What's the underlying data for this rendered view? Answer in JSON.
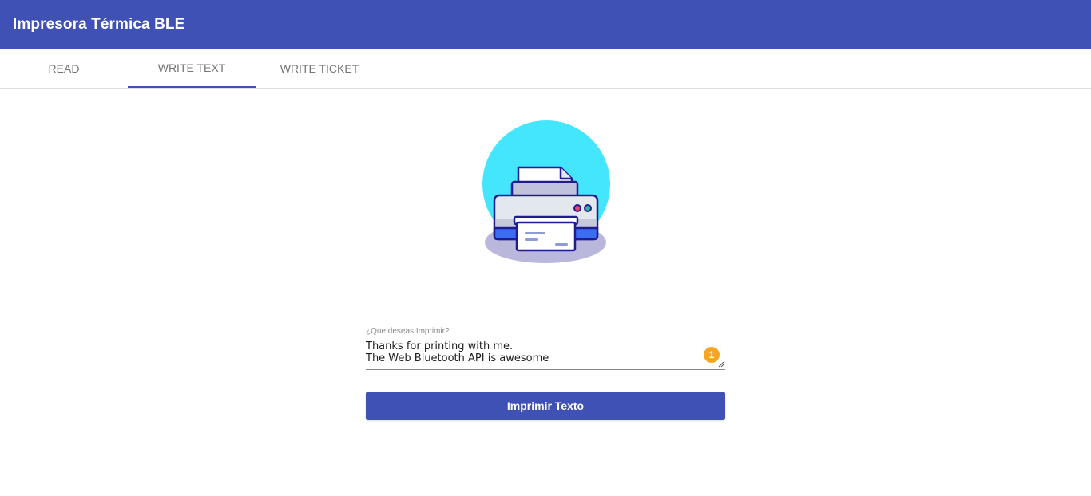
{
  "app": {
    "title": "Impresora Térmica BLE",
    "primary_color": "#3f51b5"
  },
  "tabs": [
    {
      "label": "READ",
      "active": false
    },
    {
      "label": "WRITE TEXT",
      "active": true
    },
    {
      "label": "WRITE TICKET",
      "active": false
    }
  ],
  "illustration": {
    "icon": "printer-illustration-icon",
    "circle_color": "#44e6fd"
  },
  "form": {
    "label": "¿Que deseas Imprimir?",
    "lines": [
      "Thanks for printing with me.",
      "The Web Bluetooth API is awesome"
    ],
    "badge": "1",
    "badge_color": "#f5a623",
    "submit_label": "Imprimir Texto"
  }
}
